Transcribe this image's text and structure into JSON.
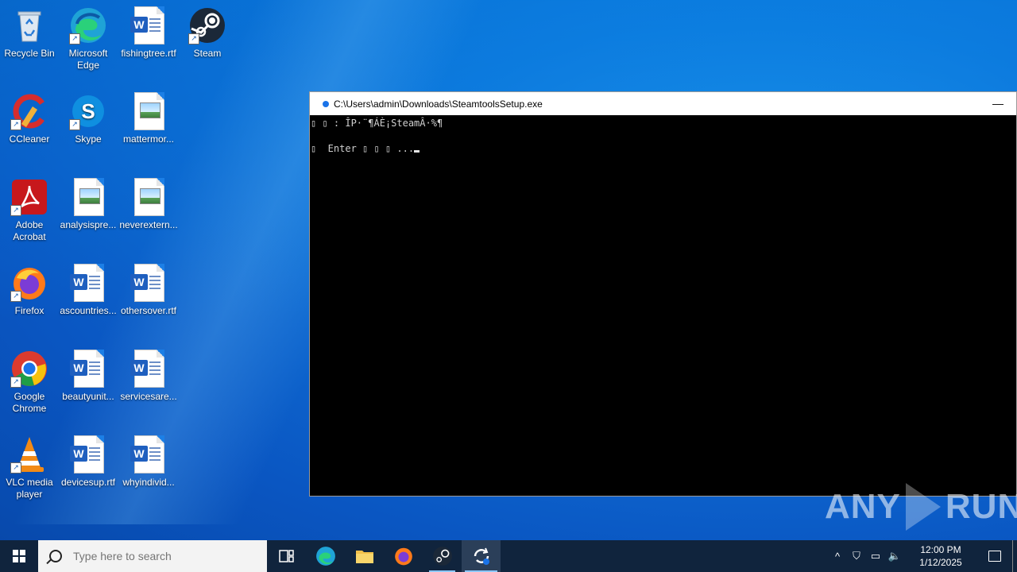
{
  "desktop": {
    "icons": [
      {
        "label": "Recycle Bin"
      },
      {
        "label": "Microsoft Edge"
      },
      {
        "label": "fishingtree.rtf"
      },
      {
        "label": "Steam"
      },
      {
        "label": "CCleaner"
      },
      {
        "label": "Skype"
      },
      {
        "label": "mattermor..."
      },
      {
        "label": "Adobe Acrobat"
      },
      {
        "label": "analysispre..."
      },
      {
        "label": "neverextern..."
      },
      {
        "label": "Firefox"
      },
      {
        "label": "ascountries..."
      },
      {
        "label": "othersover.rtf"
      },
      {
        "label": "Google Chrome"
      },
      {
        "label": "beautyunit..."
      },
      {
        "label": "servicesare..."
      },
      {
        "label": "VLC media player"
      },
      {
        "label": "devicesup.rtf"
      },
      {
        "label": "whyindivid..."
      }
    ]
  },
  "console": {
    "title": "C:\\Users\\admin\\Downloads\\SteamtoolsSetup.exe",
    "minimize_label": "—",
    "line1": "▯ ▯ : ÎP·¨¶ÁÈ¡SteamÂ·%¶",
    "line2": "▯  Enter ▯ ▯ ▯ ..."
  },
  "taskbar": {
    "search_placeholder": "Type here to search",
    "time": "12:00 PM",
    "date": "1/12/2025",
    "tray_chevron": "^"
  },
  "watermark": {
    "left": "ANY",
    "right": "RUN"
  },
  "colors": {
    "desktop_bg": "#0f6fd6",
    "taskbar_bg": "#10243d",
    "console_bg": "#000000",
    "accent": "#8cc8ff"
  }
}
